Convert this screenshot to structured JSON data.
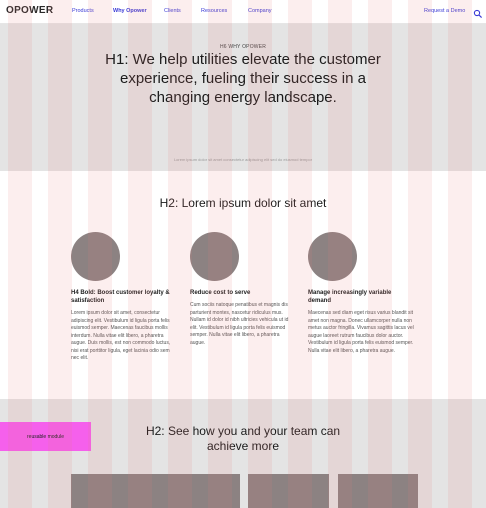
{
  "nav": {
    "logo": "OPOWER",
    "links": [
      "Products",
      "Why Opower",
      "Clients",
      "Resources",
      "Company"
    ],
    "cta": "Request a Demo",
    "search_icon": "search-icon"
  },
  "hero": {
    "eyebrow": "H6 WHY OPOWER",
    "title": "H1: We help utilities elevate the customer experience, fueling their success in a changing energy landscape.",
    "fine_print": "Lorem ipsum dolor sit amet consectetur adipiscing elit sed do eiusmod tempor"
  },
  "section2": {
    "title": "H2: Lorem ipsum dolor sit amet",
    "features": [
      {
        "title": "H4 Bold: Boost customer loyalty & satisfaction",
        "body": "Lorem ipsum dolor sit amet, consectetur adipiscing elit. Vestibulum id ligula porta felis euismod semper. Maecenas faucibus mollis interdum. Nulla vitae elit libero, a pharetra augue. Duis mollis, est non commodo luctus, nisi erat porttitor ligula, eget lacinia odio sem nec elit."
      },
      {
        "title": "Reduce cost to serve",
        "body": "Cum sociis natoque penatibus et magnis dis parturient montes, nascetur ridiculus mus. Nullam id dolor id nibh ultricies vehicula ut id elit. Vestibulum id ligula porta felis euismod semper. Nulla vitae elit libero, a pharetra augue."
      },
      {
        "title": "Manage increasingly variable demand",
        "body": "Maecenas sed diam eget risus varius blandit sit amet non magna. Donec ullamcorper nulla non metus auctor fringilla. Vivamus sagittis lacus vel augue laoreet rutrum faucibus dolor auctor. Vestibulum id ligula porta felis euismod semper. Nulla vitae elit libero, a pharetra augue."
      }
    ]
  },
  "section3": {
    "module_label": "reusable module",
    "title": "H2: See how you and your team can achieve more"
  },
  "colors": {
    "hero_bg": "#e4e4e4",
    "placeholder": "#8c8282",
    "reusable_module": "#f560ec",
    "nav_link": "#3b3bd6"
  }
}
